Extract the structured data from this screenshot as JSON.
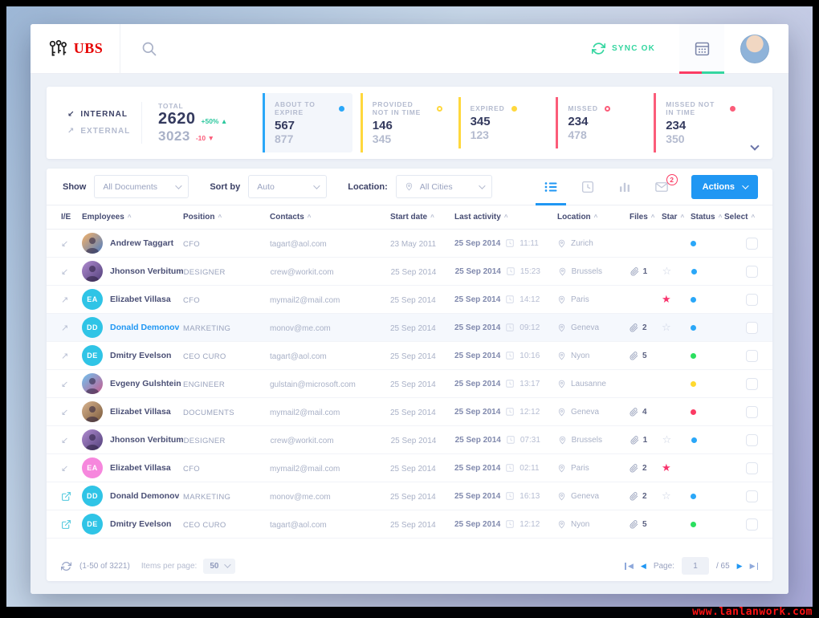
{
  "theme": {
    "brand_red": "#e60000",
    "accent_blue": "#2097f3",
    "green": "#35d6a0",
    "yellow": "#ffd83d",
    "pink": "#fb3b63"
  },
  "topbar": {
    "brand": "UBS",
    "sync_label": "SYNC OK"
  },
  "stats": {
    "internal_label": "INTERNAL",
    "external_label": "EXTERNAL",
    "total": {
      "label": "TOTAL",
      "internal_value": "2620",
      "internal_delta": "+50%",
      "external_value": "3023",
      "external_delta": "-10"
    },
    "cards": [
      {
        "label": "ABOUT TO EXPIRE",
        "top": "567",
        "bottom": "877",
        "color": "#2aa7f8",
        "dot": "filled",
        "active": true
      },
      {
        "label": "PROVIDED NOT IN TIME",
        "top": "146",
        "bottom": "345",
        "color": "#ffd83d",
        "dot": "outline",
        "active": false
      },
      {
        "label": "EXPIRED",
        "top": "345",
        "bottom": "123",
        "color": "#ffd83d",
        "dot": "filled",
        "active": false
      },
      {
        "label": "MISSED",
        "top": "234",
        "bottom": "478",
        "color": "#fb5c79",
        "dot": "outline",
        "active": false
      },
      {
        "label": "MISSED NOT IN TIME",
        "top": "234",
        "bottom": "350",
        "color": "#fb5c79",
        "dot": "filled",
        "active": false
      }
    ]
  },
  "filters": {
    "show_label": "Show",
    "show_value": "All Documents",
    "sort_label": "Sort by",
    "sort_value": "Auto",
    "location_label": "Location:",
    "location_value": "All Cities",
    "mail_badge": "2",
    "actions_label": "Actions"
  },
  "table": {
    "headers": [
      "I/E",
      "Employees",
      "Position",
      "Contacts",
      "Start date",
      "Last activity",
      "Location",
      "Files",
      "Star",
      "Status",
      "Select"
    ],
    "rows": [
      {
        "ie": "in",
        "avatar": {
          "kind": "photo",
          "variant": 1
        },
        "name": "Andrew Taggart",
        "name_highlight": false,
        "position": "CFO",
        "contact": "tagart@aol.com",
        "start_date": "23 May 2011",
        "last_date": "25 Sep 2014",
        "last_time": "11:11",
        "location": "Zurich",
        "files": null,
        "star": null,
        "status": "#2aa7f8",
        "highlighted": false
      },
      {
        "ie": "in",
        "avatar": {
          "kind": "photo",
          "variant": 2
        },
        "name": "Jhonson Verbitum",
        "name_highlight": false,
        "position": "DESIGNER",
        "contact": "crew@workit.com",
        "start_date": "25 Sep 2014",
        "last_date": "25 Sep 2014",
        "last_time": "15:23",
        "location": "Brussels",
        "files": "1",
        "star": "outline",
        "status": "#2aa7f8",
        "highlighted": false
      },
      {
        "ie": "out",
        "avatar": {
          "kind": "initials",
          "text": "EA",
          "bg": "#2fc4e6"
        },
        "name": "Elizabet Villasa",
        "name_highlight": false,
        "position": "CFO",
        "contact": "mymail2@mail.com",
        "start_date": "25 Sep 2014",
        "last_date": "25 Sep 2014",
        "last_time": "14:12",
        "location": "Paris",
        "files": null,
        "star": "filled",
        "status": "#2aa7f8",
        "highlighted": false
      },
      {
        "ie": "out",
        "avatar": {
          "kind": "initials",
          "text": "DD",
          "bg": "#2fc4e6"
        },
        "name": "Donald Demonov",
        "name_highlight": true,
        "position": "MARKETING",
        "contact": "monov@me.com",
        "start_date": "25 Sep 2014",
        "last_date": "25 Sep 2014",
        "last_time": "09:12",
        "location": "Geneva",
        "files": "2",
        "star": "outline",
        "status": "#2aa7f8",
        "highlighted": true
      },
      {
        "ie": "out",
        "avatar": {
          "kind": "initials",
          "text": "DE",
          "bg": "#2fc4e6"
        },
        "name": "Dmitry Evelson",
        "name_highlight": false,
        "position": "CEO CURO",
        "contact": "tagart@aol.com",
        "start_date": "25 Sep 2014",
        "last_date": "25 Sep 2014",
        "last_time": "10:16",
        "location": "Nyon",
        "files": "5",
        "star": null,
        "status": "#2bdf5f",
        "highlighted": false
      },
      {
        "ie": "in",
        "avatar": {
          "kind": "photo",
          "variant": 3
        },
        "name": "Evgeny Gulshtein",
        "name_highlight": false,
        "position": "ENGINEER",
        "contact": "gulstain@microsoft.com",
        "start_date": "25 Sep 2014",
        "last_date": "25 Sep 2014",
        "last_time": "13:17",
        "location": "Lausanne",
        "files": null,
        "star": null,
        "status": "#ffd92e",
        "highlighted": false
      },
      {
        "ie": "in",
        "avatar": {
          "kind": "photo",
          "variant": 4
        },
        "name": "Elizabet Villasa",
        "name_highlight": false,
        "position": "DOCUMENTS",
        "contact": "mymail2@mail.com",
        "start_date": "25 Sep 2014",
        "last_date": "25 Sep 2014",
        "last_time": "12:12",
        "location": "Geneva",
        "files": "4",
        "star": null,
        "status": "#fb3b63",
        "highlighted": false
      },
      {
        "ie": "in",
        "avatar": {
          "kind": "photo",
          "variant": 2
        },
        "name": "Jhonson Verbitum",
        "name_highlight": false,
        "position": "DESIGNER",
        "contact": "crew@workit.com",
        "start_date": "25 Sep 2014",
        "last_date": "25 Sep 2014",
        "last_time": "07:31",
        "location": "Brussels",
        "files": "1",
        "star": "outline",
        "status": "#2aa7f8",
        "highlighted": false
      },
      {
        "ie": "in",
        "avatar": {
          "kind": "initials",
          "text": "EA",
          "bg": "#f687dd"
        },
        "name": "Elizabet Villasa",
        "name_highlight": false,
        "position": "CFO",
        "contact": "mymail2@mail.com",
        "start_date": "25 Sep 2014",
        "last_date": "25 Sep 2014",
        "last_time": "02:11",
        "location": "Paris",
        "files": "2",
        "star": "filled",
        "status": null,
        "highlighted": false
      },
      {
        "ie": "open",
        "avatar": {
          "kind": "initials",
          "text": "DD",
          "bg": "#2fc4e6"
        },
        "name": "Donald Demonov",
        "name_highlight": false,
        "position": "MARKETING",
        "contact": "monov@me.com",
        "start_date": "25 Sep 2014",
        "last_date": "25 Sep 2014",
        "last_time": "16:13",
        "location": "Geneva",
        "files": "2",
        "star": "outline",
        "status": "#2aa7f8",
        "highlighted": false
      },
      {
        "ie": "open",
        "avatar": {
          "kind": "initials",
          "text": "DE",
          "bg": "#2fc4e6"
        },
        "name": "Dmitry Evelson",
        "name_highlight": false,
        "position": "CEO CURO",
        "contact": "tagart@aol.com",
        "start_date": "25 Sep 2014",
        "last_date": "25 Sep 2014",
        "last_time": "12:12",
        "location": "Nyon",
        "files": "5",
        "star": null,
        "status": "#2bdf5f",
        "highlighted": false
      }
    ]
  },
  "pagination": {
    "range": "(1-50 of 3221)",
    "items_per_page_label": "Items per page:",
    "items_per_page": "50",
    "page_label": "Page:",
    "page": "1",
    "total_pages": "/ 65"
  },
  "watermark": "www.lanlanwork.com"
}
